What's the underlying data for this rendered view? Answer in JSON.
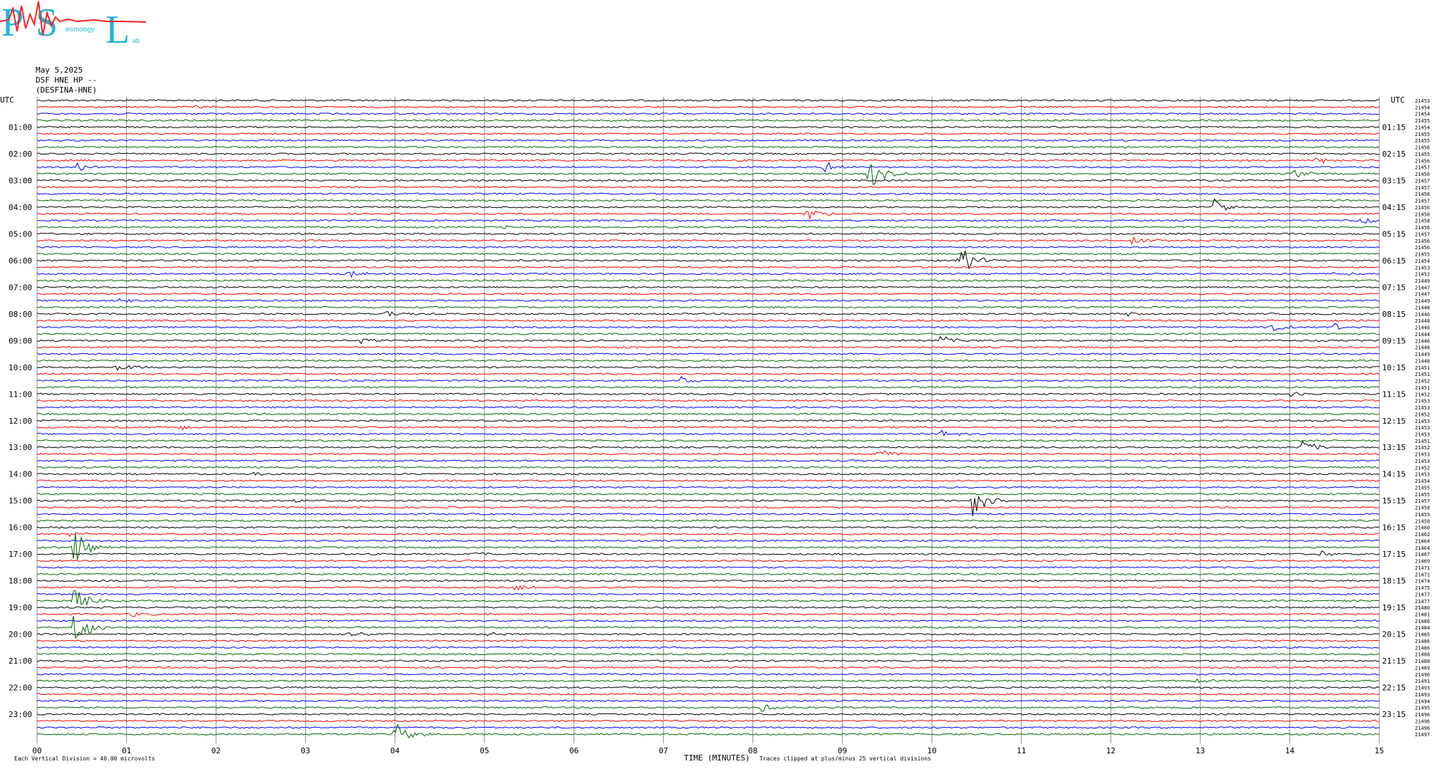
{
  "logo": {
    "letters": [
      "P",
      "S",
      "L"
    ],
    "words": [
      "eismology",
      "ab"
    ],
    "colors": {
      "primary": "#1fb6d8",
      "trace": "#ff2020"
    }
  },
  "header": {
    "date": "May 5,2025",
    "station": "DSF HNE HP --",
    "station_name": "(DESFINA-HNE)"
  },
  "axis": {
    "left_corner": "UTC",
    "right_corner": "UTC",
    "xlabel": "TIME (MINUTES)",
    "scale_note": "Each Vertical Division =   40.00 microvolts",
    "clip_note": "Traces clipped at plus/minus 25 vertical divisions"
  },
  "chart_data": {
    "type": "line",
    "title": "",
    "x_ticks": [
      "00",
      "01",
      "02",
      "03",
      "04",
      "05",
      "06",
      "07",
      "08",
      "09",
      "10",
      "11",
      "12",
      "13",
      "14",
      "15"
    ],
    "xlim": [
      0,
      15
    ],
    "grid": true,
    "trace_colors": [
      "#000000",
      "#ff0000",
      "#0000ff",
      "#006400"
    ],
    "trace_count": 96,
    "left_hour_labels": [
      "01:00",
      "02:00",
      "03:00",
      "04:00",
      "05:00",
      "06:00",
      "07:00",
      "08:00",
      "09:00",
      "10:00",
      "11:00",
      "12:00",
      "13:00",
      "14:00",
      "15:00",
      "16:00",
      "17:00",
      "18:00",
      "19:00",
      "20:00",
      "21:00",
      "22:00",
      "23:00"
    ],
    "right_hour_labels": [
      "01:15",
      "02:15",
      "03:15",
      "04:15",
      "05:15",
      "06:15",
      "07:15",
      "08:15",
      "09:15",
      "10:15",
      "11:15",
      "12:15",
      "13:15",
      "14:15",
      "15:15",
      "16:15",
      "17:15",
      "18:15",
      "19:15",
      "20:15",
      "21:15",
      "22:15",
      "23:15"
    ],
    "right_values": [
      "21453",
      "21454",
      "21454",
      "21455",
      "21454",
      "21455",
      "21455",
      "21456",
      "21455",
      "21456",
      "21457",
      "21456",
      "21457",
      "21457",
      "21458",
      "21457",
      "21456",
      "21458",
      "21458",
      "21456",
      "21457",
      "21456",
      "21456",
      "21455",
      "21454",
      "21453",
      "21452",
      "21449",
      "21447",
      "21447",
      "21449",
      "21448",
      "21446",
      "21448",
      "21446",
      "21444",
      "21446",
      "21448",
      "21449",
      "21448",
      "21451",
      "21451",
      "21452",
      "21451",
      "21452",
      "21453",
      "21453",
      "21452",
      "21453",
      "21453",
      "21453",
      "21451",
      "21452",
      "21453",
      "21453",
      "21452",
      "21453",
      "21454",
      "21455",
      "21455",
      "21457",
      "21458",
      "21459",
      "21458",
      "21460",
      "21462",
      "21464",
      "21464",
      "21467",
      "21469",
      "21471",
      "21471",
      "21474",
      "21475",
      "21477",
      "21477",
      "21480",
      "21481",
      "21486",
      "21484",
      "21485",
      "21486",
      "21486",
      "21488",
      "21488",
      "21489",
      "21490",
      "21491",
      "21493",
      "21493",
      "21494",
      "21495",
      "21496",
      "21496",
      "21496",
      "21497"
    ],
    "events": [
      {
        "trace": 1,
        "minute": 1.8,
        "amp": 4
      },
      {
        "trace": 9,
        "minute": 14.3,
        "amp": 5
      },
      {
        "trace": 10,
        "minute": 0.45,
        "amp": 6
      },
      {
        "trace": 10,
        "minute": 8.8,
        "amp": 8
      },
      {
        "trace": 11,
        "minute": 9.3,
        "amp": 22
      },
      {
        "trace": 11,
        "minute": 14.05,
        "amp": 9
      },
      {
        "trace": 16,
        "minute": 13.15,
        "amp": 14
      },
      {
        "trace": 17,
        "minute": 8.6,
        "amp": 12
      },
      {
        "trace": 18,
        "minute": 14.8,
        "amp": 6
      },
      {
        "trace": 19,
        "minute": 5.2,
        "amp": 4
      },
      {
        "trace": 21,
        "minute": 12.25,
        "amp": 11
      },
      {
        "trace": 24,
        "minute": 10.3,
        "amp": 26
      },
      {
        "trace": 26,
        "minute": 3.5,
        "amp": 5
      },
      {
        "trace": 26,
        "minute": 14.5,
        "amp": 5
      },
      {
        "trace": 30,
        "minute": 0.9,
        "amp": 5
      },
      {
        "trace": 32,
        "minute": 3.9,
        "amp": 6
      },
      {
        "trace": 32,
        "minute": 12.2,
        "amp": 5
      },
      {
        "trace": 34,
        "minute": 13.8,
        "amp": 6
      },
      {
        "trace": 34,
        "minute": 14.5,
        "amp": 6
      },
      {
        "trace": 36,
        "minute": 10.1,
        "amp": 8
      },
      {
        "trace": 36,
        "minute": 3.6,
        "amp": 5
      },
      {
        "trace": 37,
        "minute": 6.5,
        "amp": 4
      },
      {
        "trace": 40,
        "minute": 0.9,
        "amp": 6
      },
      {
        "trace": 42,
        "minute": 7.2,
        "amp": 5
      },
      {
        "trace": 44,
        "minute": 14.0,
        "amp": 5
      },
      {
        "trace": 49,
        "minute": 1.6,
        "amp": 4
      },
      {
        "trace": 50,
        "minute": 10.1,
        "amp": 6
      },
      {
        "trace": 52,
        "minute": 14.15,
        "amp": 12
      },
      {
        "trace": 53,
        "minute": 9.4,
        "amp": 9
      },
      {
        "trace": 56,
        "minute": 2.4,
        "amp": 4
      },
      {
        "trace": 60,
        "minute": 10.45,
        "amp": 24
      },
      {
        "trace": 60,
        "minute": 2.85,
        "amp": 4
      },
      {
        "trace": 65,
        "minute": 0.38,
        "amp": 6
      },
      {
        "trace": 67,
        "minute": 0.42,
        "amp": 28
      },
      {
        "trace": 68,
        "minute": 4.9,
        "amp": 4
      },
      {
        "trace": 68,
        "minute": 14.35,
        "amp": 4
      },
      {
        "trace": 73,
        "minute": 5.35,
        "amp": 6
      },
      {
        "trace": 75,
        "minute": 0.42,
        "amp": 24
      },
      {
        "trace": 77,
        "minute": 1.05,
        "amp": 5
      },
      {
        "trace": 79,
        "minute": 0.42,
        "amp": 28
      },
      {
        "trace": 80,
        "minute": 3.5,
        "amp": 5
      },
      {
        "trace": 80,
        "minute": 5.05,
        "amp": 4
      },
      {
        "trace": 87,
        "minute": 12.95,
        "amp": 5
      },
      {
        "trace": 91,
        "minute": 8.1,
        "amp": 6
      },
      {
        "trace": 95,
        "minute": 4.0,
        "amp": 18
      }
    ]
  }
}
